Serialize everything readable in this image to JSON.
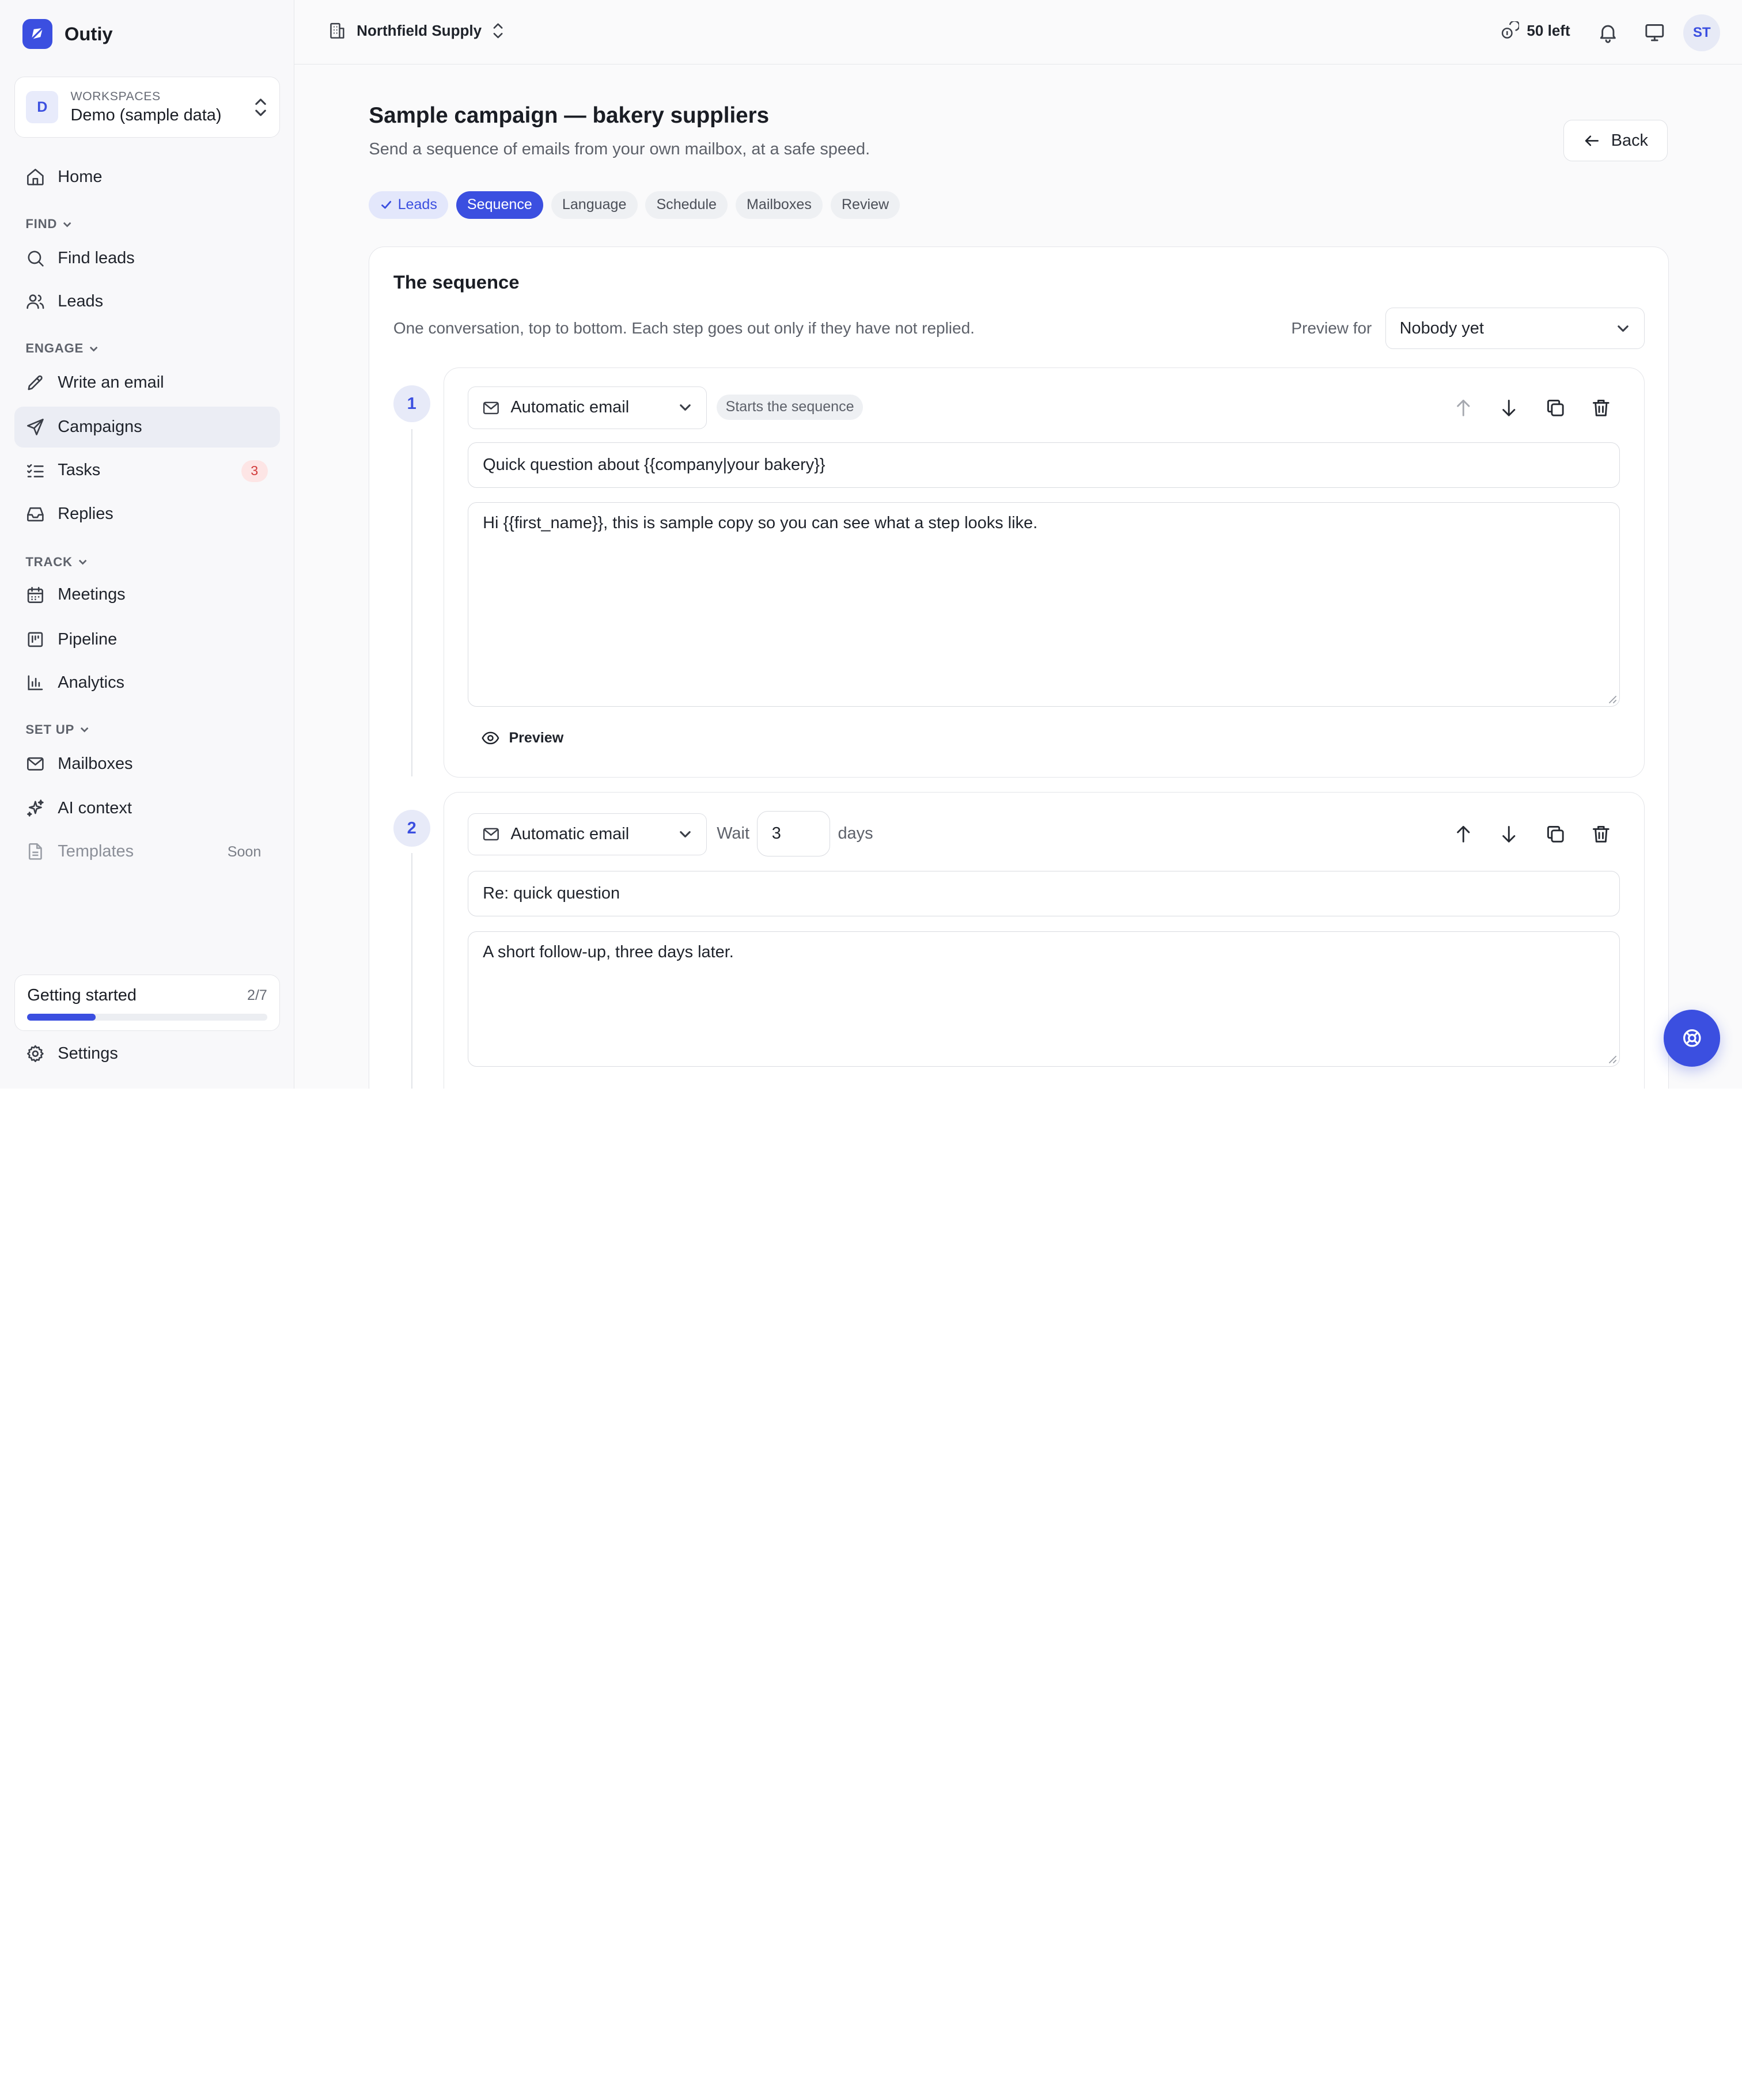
{
  "brand": {
    "name": "Outiy"
  },
  "workspace": {
    "avatar": "D",
    "label": "WORKSPACES",
    "name": "Demo (sample data)"
  },
  "nav": {
    "home": "Home",
    "find": {
      "section": "FIND",
      "find_leads": "Find leads",
      "leads": "Leads"
    },
    "engage": {
      "section": "ENGAGE",
      "write_email": "Write an email",
      "campaigns": "Campaigns",
      "tasks": "Tasks",
      "tasks_badge": "3",
      "replies": "Replies"
    },
    "track": {
      "section": "TRACK",
      "meetings": "Meetings",
      "pipeline": "Pipeline",
      "analytics": "Analytics"
    },
    "setup": {
      "section": "SET UP",
      "mailboxes": "Mailboxes",
      "ai_context": "AI context",
      "templates": "Templates",
      "templates_badge": "Soon"
    },
    "settings": "Settings"
  },
  "getting_started": {
    "title": "Getting started",
    "count": "2/7",
    "progress": 0.2857
  },
  "topbar": {
    "org": "Northfield Supply",
    "credits": "50 left",
    "avatar": "ST"
  },
  "page": {
    "title": "Sample campaign — bakery suppliers",
    "subtitle": "Send a sequence of emails from your own mailbox, at a safe speed.",
    "back": "Back"
  },
  "wizard": {
    "steps": [
      "Leads",
      "Sequence",
      "Language",
      "Schedule",
      "Mailboxes",
      "Review"
    ],
    "completed": [
      "Leads"
    ],
    "current": "Sequence"
  },
  "sequence": {
    "title": "The sequence",
    "description": "One conversation, top to bottom. Each step goes out only if they have not replied.",
    "preview_for_label": "Preview for",
    "preview_for_value": "Nobody yet",
    "steps": [
      {
        "number": "1",
        "type": "Automatic email",
        "tag": "Starts the sequence",
        "subject": "Quick question about {{company|your bakery}}",
        "body": "Hi {{first_name}}, this is sample copy so you can see what a step looks like.",
        "preview_label": "Preview"
      },
      {
        "number": "2",
        "type": "Automatic email",
        "wait_label": "Wait",
        "wait_value": "3",
        "wait_unit": "days",
        "subject": "Re: quick question",
        "body": "A short follow-up, three days later."
      }
    ]
  },
  "colors": {
    "accent": "#3b4fe0",
    "badge_red": "#d13a3a",
    "text": "#1a1d24",
    "muted": "#5d616a"
  }
}
